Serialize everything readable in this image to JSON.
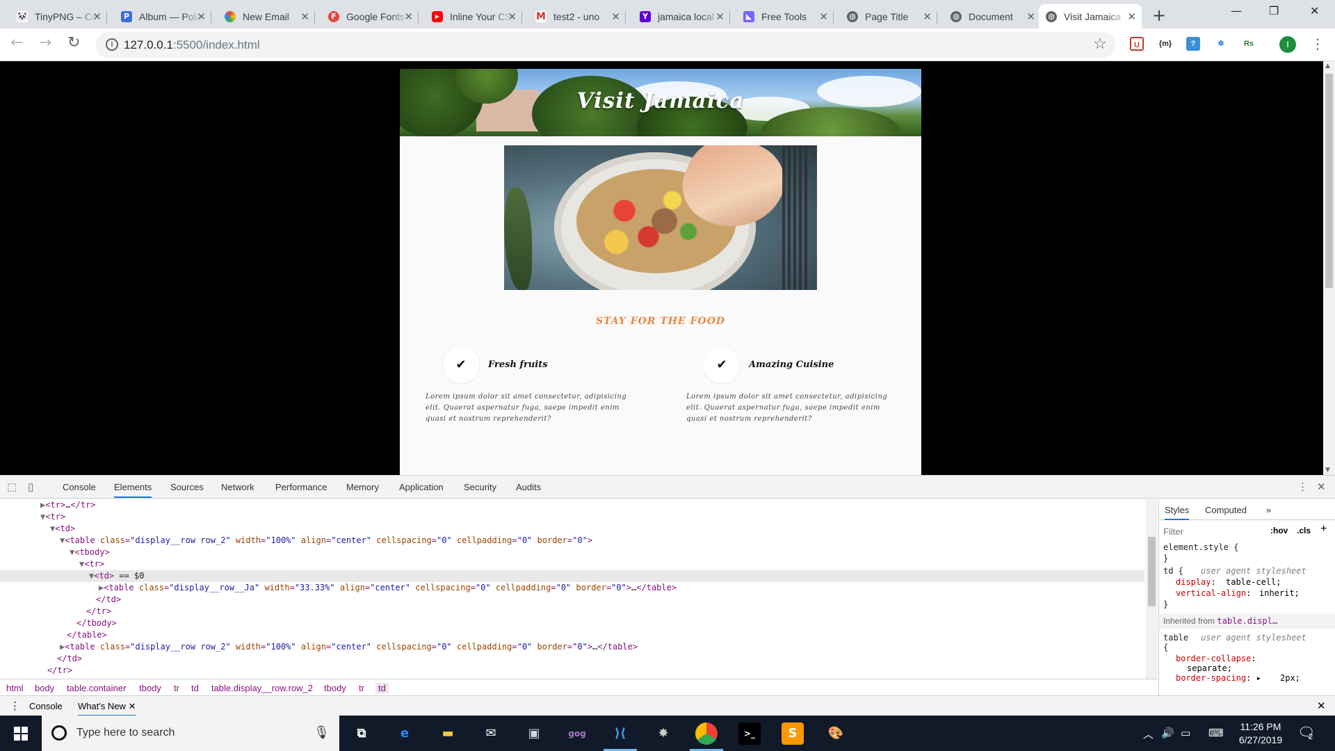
{
  "browser": {
    "tabs": [
      {
        "title": "TinyPNG – Compress",
        "icon": "panda-icon"
      },
      {
        "title": "Album — Polarr",
        "icon": "album-icon"
      },
      {
        "title": "New Email",
        "icon": "email-icon"
      },
      {
        "title": "Google Fonts",
        "icon": "google-fonts-icon"
      },
      {
        "title": "Inline Your CSS",
        "icon": "youtube-icon"
      },
      {
        "title": "test2 - uno",
        "icon": "gmail-icon"
      },
      {
        "title": "jamaica local",
        "icon": "yahoo-icon"
      },
      {
        "title": "Free Tools",
        "icon": "tools-icon"
      },
      {
        "title": "Page Title",
        "icon": "globe-icon"
      },
      {
        "title": "Document",
        "icon": "globe-icon"
      },
      {
        "title": "Visit Jamaica",
        "icon": "globe-icon"
      }
    ],
    "url_host": "127.0.0.1",
    "url_rest": ":5500/index.html",
    "profile_initial": "I",
    "extensions": [
      "U",
      "{m}",
      "?",
      "✲",
      "Rs"
    ]
  },
  "email": {
    "hero_title": "Visit Jamaica",
    "tagline": "STAY FOR THE FOOD",
    "features": [
      {
        "heading": "Fresh fruits",
        "body": "Lorem ipsum dolor sit amet consectetur, adipisicing elit. Quaerat aspernatur fuga, saepe impedit enim quasi et nostrum reprehenderit?"
      },
      {
        "heading": "Amazing Cuisine",
        "body": "Lorem ipsum dolor sit amet consectetur, adipisicing elit. Quaerat aspernatur fuga, saepe impedit enim quasi et nostrum reprehenderit?"
      }
    ]
  },
  "devtools": {
    "tabs": [
      "Console",
      "Elements",
      "Sources",
      "Network",
      "Performance",
      "Memory",
      "Application",
      "Security",
      "Audits"
    ],
    "active_tab": "Elements",
    "breadcrumbs": [
      "html",
      "body",
      "table.container",
      "tbody",
      "tr",
      "td",
      "table.display__row.row_2",
      "tbody",
      "tr",
      "td"
    ],
    "styles_tabs": [
      "Styles",
      "Computed"
    ],
    "filter_placeholder": "Filter",
    "hov": ":hov",
    "cls": ".cls",
    "element_style": "element.style {",
    "ua_label": "user agent stylesheet",
    "td_display": "table-cell;",
    "td_valign": "inherit;",
    "inherited_from": "Inherited from",
    "inherited_target": "table.displ…",
    "border_collapse": "separate;",
    "border_spacing": "2px;",
    "drawer_tabs": [
      "Console",
      "What's New"
    ]
  },
  "taskbar": {
    "search_placeholder": "Type here to search",
    "time": "11:26 PM",
    "date": "6/27/2019",
    "notifications": "2"
  }
}
